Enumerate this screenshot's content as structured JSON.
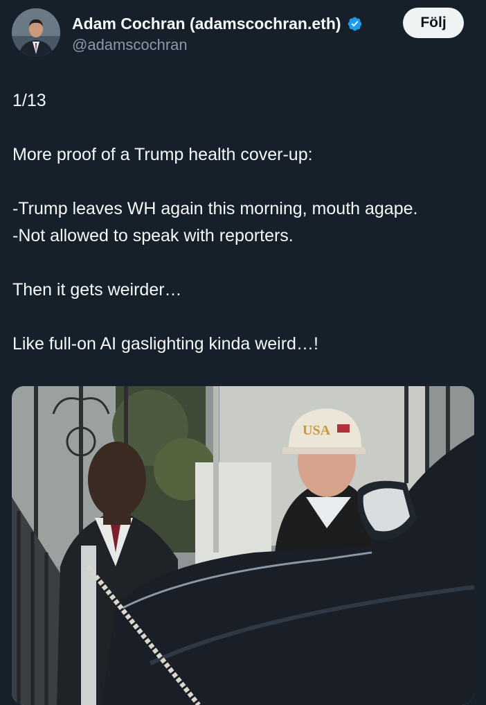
{
  "author": {
    "display_name": "Adam Cochran (adamscochran.eth)",
    "handle": "@adamscochran",
    "verified_icon": "verified-badge-icon"
  },
  "actions": {
    "follow_label": "Följ"
  },
  "tweet": {
    "lines": [
      "1/13",
      "",
      "More proof of a Trump health cover-up:",
      "",
      "-Trump leaves WH again this morning, mouth agape.",
      "-Not allowed to speak with reporters.",
      "",
      "Then it gets weirder…",
      "",
      "Like full-on AI gaslighting kinda weird…!"
    ]
  },
  "media": {
    "cap_text": "USA"
  },
  "colors": {
    "background": "#15202b",
    "text": "#f7f9f9",
    "secondary_text": "#8b98a5",
    "verified_blue": "#1d9bf0",
    "button_bg": "#eff3f4"
  }
}
